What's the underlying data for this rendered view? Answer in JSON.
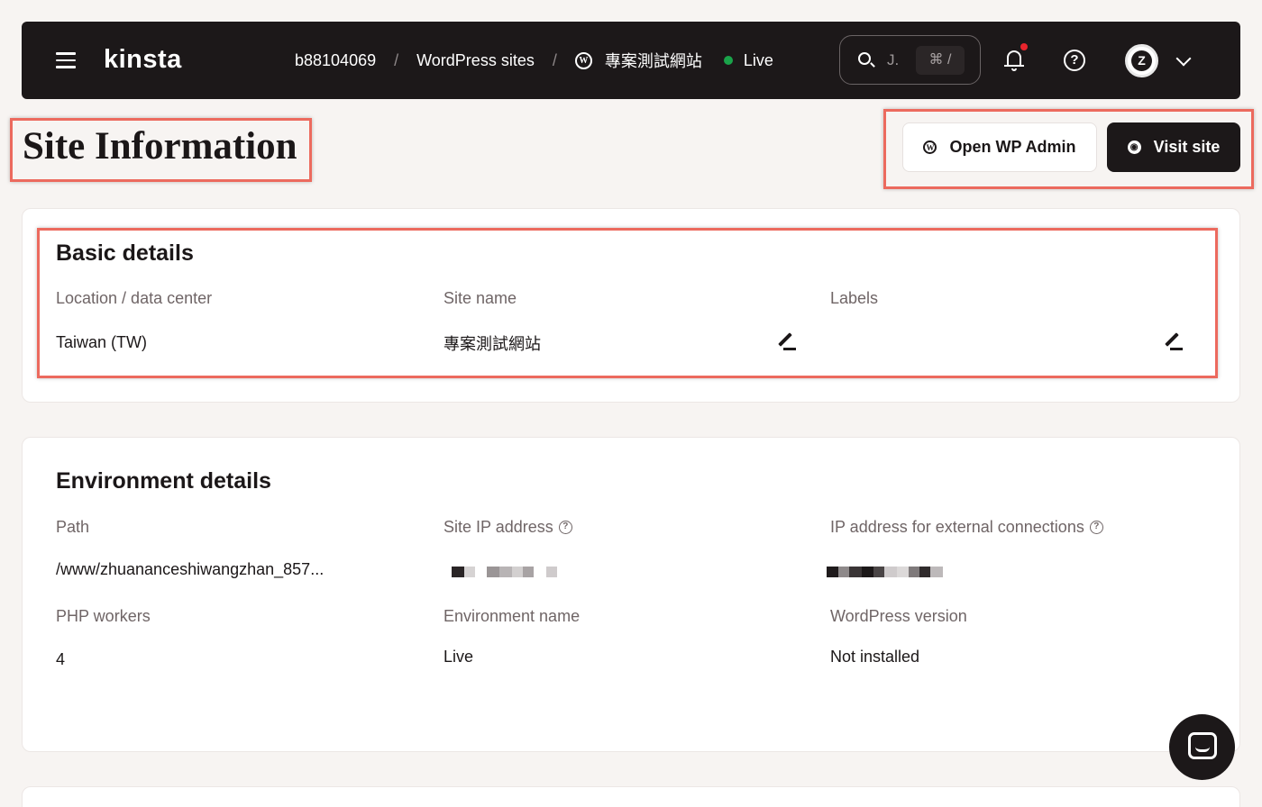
{
  "topbar": {
    "logo": "kinsta",
    "breadcrumbs": [
      "b88104069",
      "WordPress sites",
      "專案測試網站"
    ],
    "separator": "/",
    "wp_glyph": "W",
    "status": "Live",
    "search_placeholder": "J.",
    "search_shortcut": "⌘ /",
    "help_glyph": "?",
    "avatar_initial": "Z"
  },
  "page": {
    "title": "Site Information",
    "open_wp_admin_label": "Open WP Admin",
    "visit_site_label": "Visit site"
  },
  "basic_details": {
    "title": "Basic details",
    "location_label": "Location / data center",
    "location_value": "Taiwan (TW)",
    "site_name_label": "Site name",
    "site_name_value": "專案測試網站",
    "labels_label": "Labels"
  },
  "environment_details": {
    "title": "Environment details",
    "path_label": "Path",
    "path_value": "/www/zhuananceshiwangzhan_857...",
    "site_ip_label": "Site IP address",
    "external_ip_label": "IP address for external connections",
    "php_workers_label": "PHP workers",
    "php_workers_value": "4",
    "environment_name_label": "Environment name",
    "environment_name_value": "Live",
    "wordpress_version_label": "WordPress version",
    "wordpress_version_value": "Not installed"
  },
  "colors": {
    "topbar_bg": "#1c1819",
    "page_bg": "#f7f4f2",
    "live_status": "#1aa34a",
    "notification_dot": "#e8252d",
    "annotation_outline": "#ec6a5e"
  },
  "icons": [
    "hamburger-icon",
    "wordpress-icon",
    "search-icon",
    "bell-icon",
    "help-icon",
    "chevron-down-icon",
    "globe-icon",
    "edit-icon",
    "info-icon",
    "chat-icon"
  ]
}
